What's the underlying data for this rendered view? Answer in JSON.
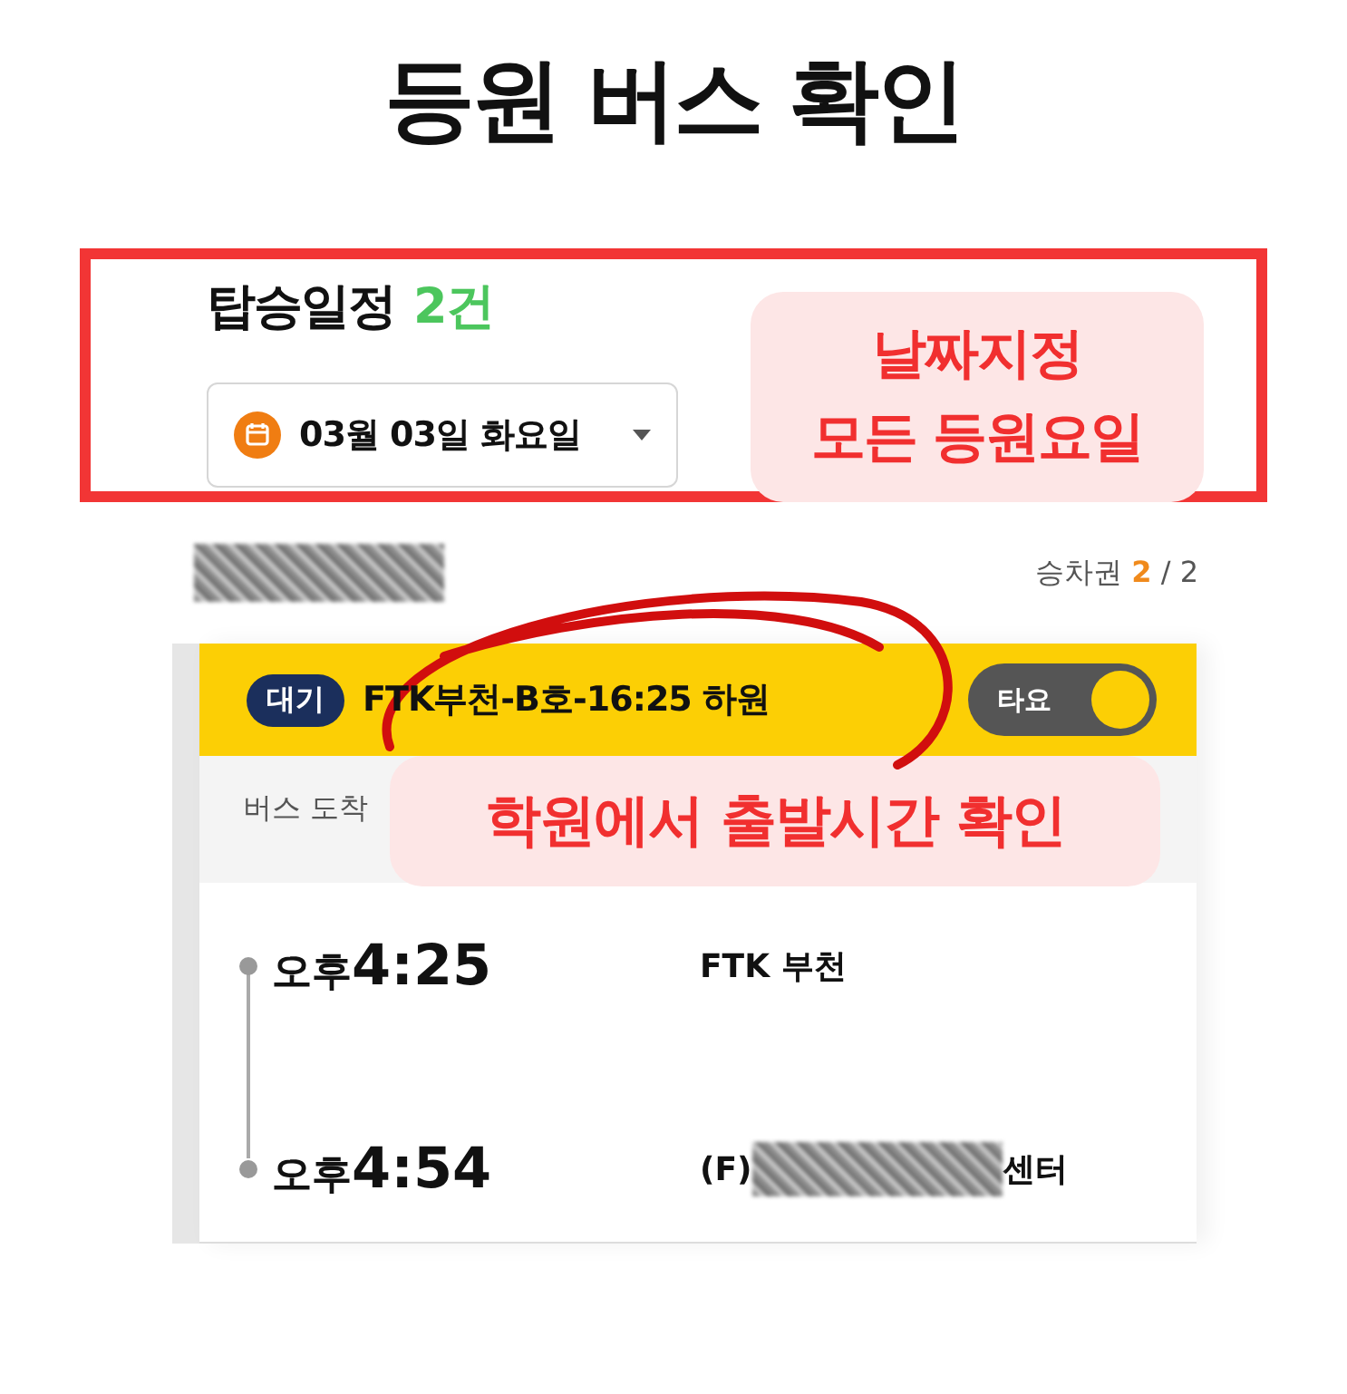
{
  "title": "등원 버스 확인",
  "schedule": {
    "heading": "탑승일정",
    "count": "2건",
    "date": "03월 03일 화요일"
  },
  "callouts": [
    "날짜지정\n모든 등원요일",
    "학원에서 출발시간 확인"
  ],
  "passenger": {
    "name_redacted": true,
    "ticket_label": "승차권",
    "ticket_current": "2",
    "ticket_total": "/ 2"
  },
  "card": {
    "status": "대기",
    "route": "FTK부천-B호-16:25 하원",
    "toggle": {
      "label": "타요",
      "on": true
    },
    "subheader": "버스 도착",
    "stops": [
      {
        "meridiem": "오후",
        "time": "4:25",
        "place_prefix": "FTK 부천",
        "redacted": false
      },
      {
        "meridiem": "오후",
        "time": "4:54",
        "place_prefix": "(F)",
        "redacted": true,
        "place_suffix": "센터"
      }
    ]
  }
}
